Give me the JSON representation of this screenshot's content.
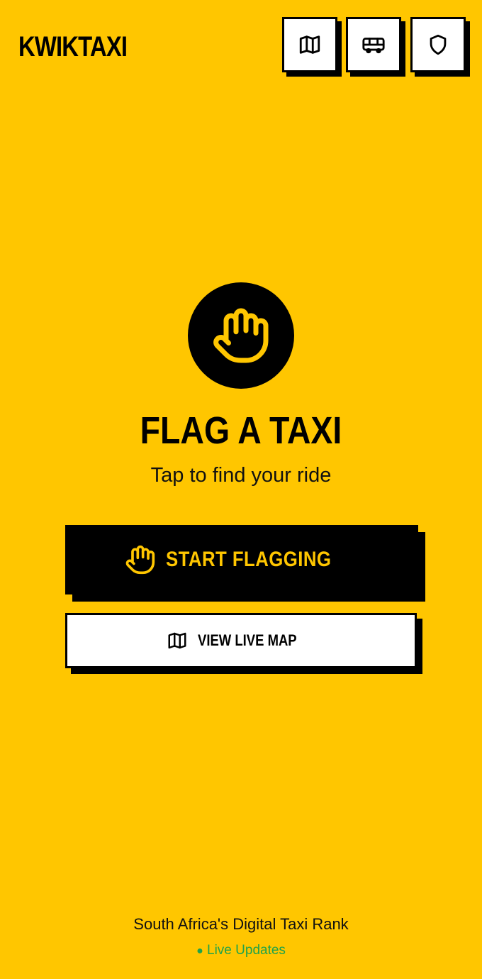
{
  "header": {
    "brand": "KWIKTAXI",
    "nav": [
      {
        "icon": "map-icon"
      },
      {
        "icon": "bus-icon"
      },
      {
        "icon": "shield-icon"
      }
    ]
  },
  "hero": {
    "icon": "raised-hand-icon",
    "title": "FLAG A TAXI",
    "subtitle": "Tap to find your ride"
  },
  "actions": {
    "primary_label": "START FLAGGING",
    "primary_icon": "raised-hand-icon",
    "secondary_label": "VIEW LIVE MAP",
    "secondary_icon": "map-icon"
  },
  "footer": {
    "tagline": "South Africa's Digital Taxi Rank",
    "status_dot": "●",
    "status": "Live Updates"
  },
  "colors": {
    "background": "#FFC600",
    "primary": "#000000",
    "accent_text": "#FFC600",
    "live_status": "#1FA34A"
  }
}
